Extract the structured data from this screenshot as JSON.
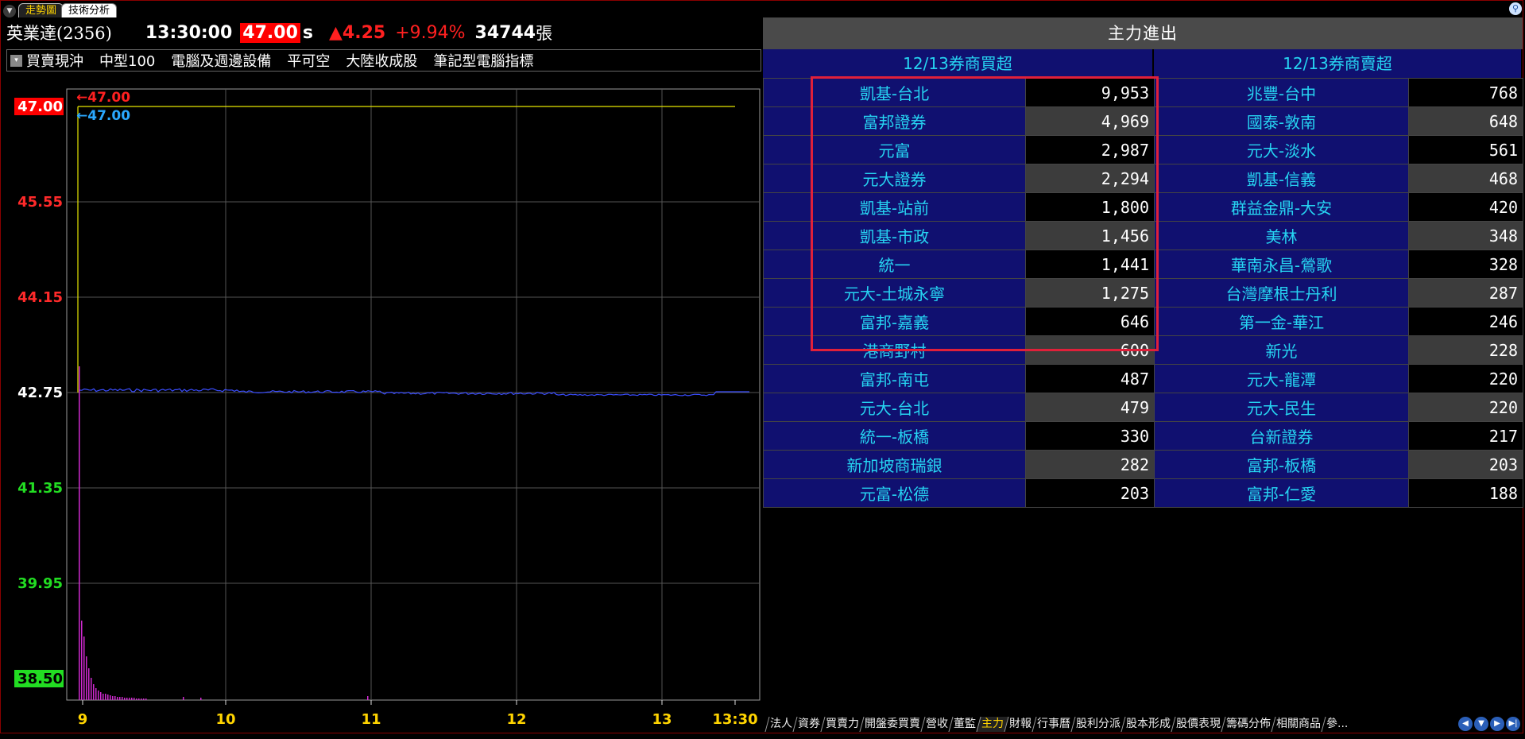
{
  "tabs": {
    "active": "走勢圖",
    "inactive": "技術分析"
  },
  "quote": {
    "name": "英業達(2356)",
    "time": "13:30:00",
    "price": "47.00",
    "price_suffix": "s",
    "change_arrow": "▲",
    "change": "4.25",
    "change_pct": "+9.94%",
    "volume": "34744",
    "volume_unit": "張"
  },
  "tags": [
    "買賣現沖",
    "中型100",
    "電腦及週邊設備",
    "平可空",
    "大陸收成股",
    "筆記型電腦指標"
  ],
  "chart_data": {
    "type": "line",
    "y_ticks": [
      "47.00",
      "45.55",
      "44.15",
      "42.75",
      "41.35",
      "39.95",
      "38.50"
    ],
    "y_tick_colors": [
      "#ff0000",
      "#ff2a2a",
      "#ff2a2a",
      "#ffffff",
      "#22dd22",
      "#22dd22",
      "#22dd22"
    ],
    "y_range": [
      38.5,
      47.0
    ],
    "x_ticks": [
      "9",
      "10",
      "11",
      "12",
      "13",
      "13:30"
    ],
    "high_label": "←47.00",
    "low_label": "←47.00",
    "price_series_color": "#3a4dff",
    "volume_color": "#d12ad1",
    "approx_level": 42.75
  },
  "panel": {
    "title": "主力進出",
    "buy_header": "12/13券商買超",
    "sell_header": "12/13券商賣超",
    "rows": [
      {
        "buy_name": "凱基-台北",
        "buy_val": "9,953",
        "sell_name": "兆豐-台中",
        "sell_val": "768"
      },
      {
        "buy_name": "富邦證券",
        "buy_val": "4,969",
        "sell_name": "國泰-敦南",
        "sell_val": "648"
      },
      {
        "buy_name": "元富",
        "buy_val": "2,987",
        "sell_name": "元大-淡水",
        "sell_val": "561"
      },
      {
        "buy_name": "元大證券",
        "buy_val": "2,294",
        "sell_name": "凱基-信義",
        "sell_val": "468"
      },
      {
        "buy_name": "凱基-站前",
        "buy_val": "1,800",
        "sell_name": "群益金鼎-大安",
        "sell_val": "420"
      },
      {
        "buy_name": "凱基-市政",
        "buy_val": "1,456",
        "sell_name": "美林",
        "sell_val": "348"
      },
      {
        "buy_name": "統一",
        "buy_val": "1,441",
        "sell_name": "華南永昌-鶯歌",
        "sell_val": "328"
      },
      {
        "buy_name": "元大-土城永寧",
        "buy_val": "1,275",
        "sell_name": "台灣摩根士丹利",
        "sell_val": "287"
      },
      {
        "buy_name": "富邦-嘉義",
        "buy_val": "646",
        "sell_name": "第一金-華江",
        "sell_val": "246"
      },
      {
        "buy_name": "港商野村",
        "buy_val": "600",
        "sell_name": "新光",
        "sell_val": "228"
      },
      {
        "buy_name": "富邦-南屯",
        "buy_val": "487",
        "sell_name": "元大-龍潭",
        "sell_val": "220"
      },
      {
        "buy_name": "元大-台北",
        "buy_val": "479",
        "sell_name": "元大-民生",
        "sell_val": "220"
      },
      {
        "buy_name": "統一-板橋",
        "buy_val": "330",
        "sell_name": "台新證券",
        "sell_val": "217"
      },
      {
        "buy_name": "新加坡商瑞銀",
        "buy_val": "282",
        "sell_name": "富邦-板橋",
        "sell_val": "203"
      },
      {
        "buy_name": "元富-松德",
        "buy_val": "203",
        "sell_name": "富邦-仁愛",
        "sell_val": "188"
      }
    ]
  },
  "bottom_tabs": [
    "法人",
    "資券",
    "買賣力",
    "開盤委買賣",
    "營收",
    "董監",
    "主力",
    "財報",
    "行事曆",
    "股利分派",
    "股本形成",
    "股價表現",
    "籌碼分佈",
    "相關商品",
    "參..."
  ],
  "bottom_active": "主力",
  "icons": [
    "dropdown-icon",
    "search-icon",
    "checkbox-icon",
    "nav-prev-icon",
    "nav-down-icon",
    "nav-next-icon",
    "nav-end-icon"
  ]
}
